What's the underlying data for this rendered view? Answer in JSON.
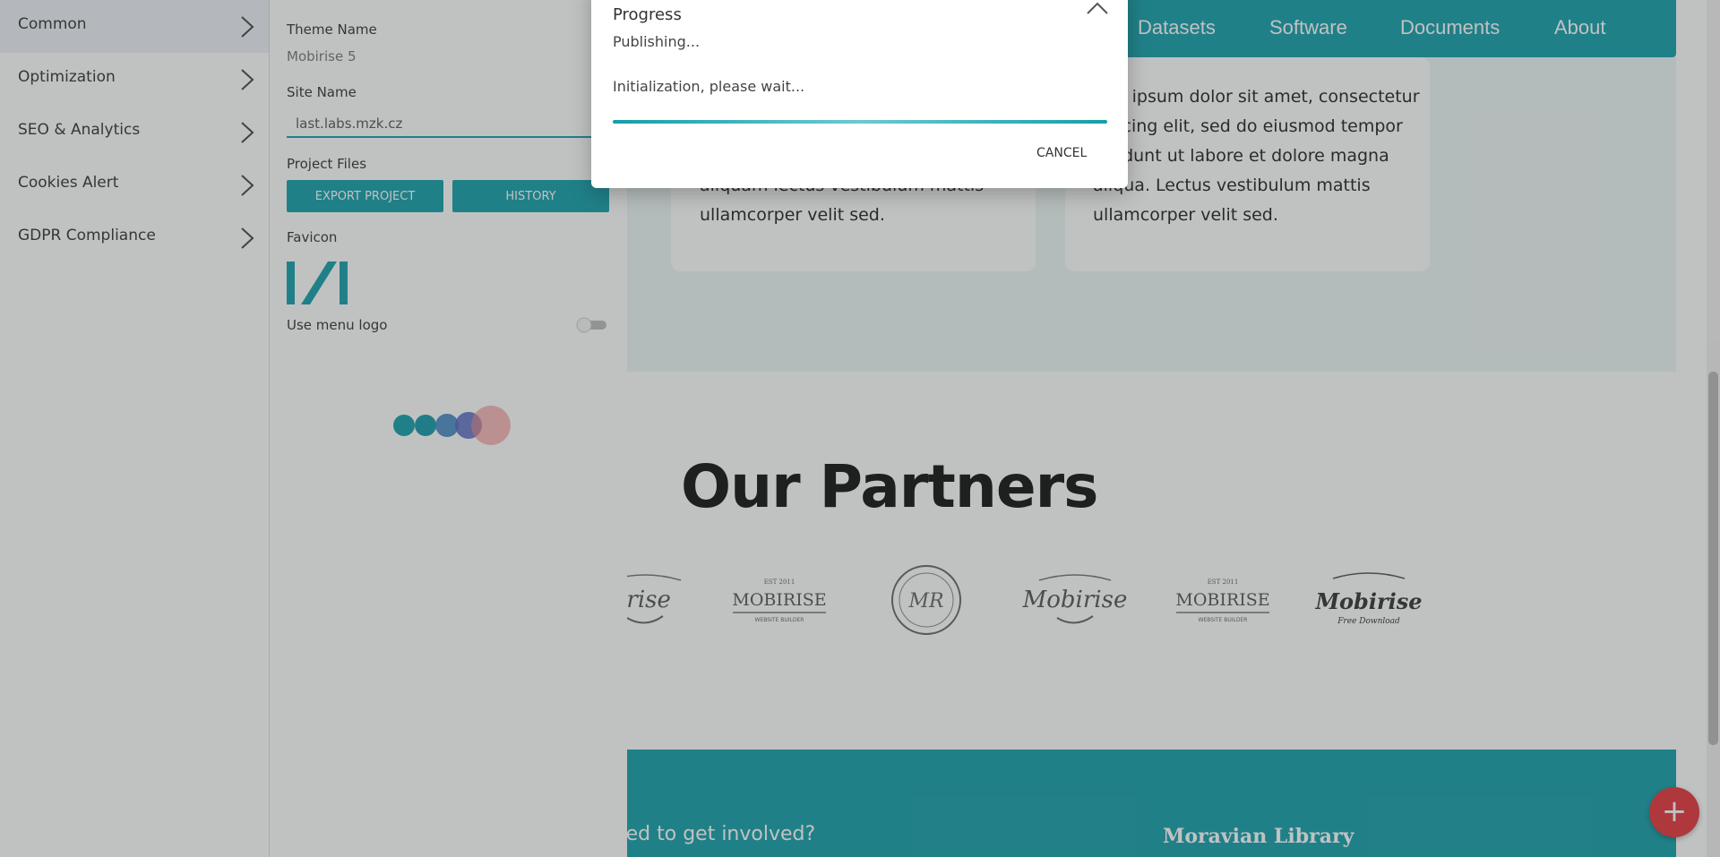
{
  "site": {
    "nav": [
      "Datasets",
      "Software",
      "Documents",
      "About"
    ],
    "cards": [
      {
        "lines": [
          "aliquam lectus vestibulum mattis",
          "ullamcorper velit sed."
        ]
      },
      {
        "lines": [
          "rem ipsum dolor sit amet, consectetur",
          "ipiscing elit, sed do eiusmod tempor",
          "cididunt ut labore et dolore magna",
          "aliqua. Lectus vestibulum mattis",
          "ullamcorper velit sed."
        ]
      }
    ],
    "partners_title": "Our Partners",
    "partner_logos": [
      "mobirise-script-logo",
      "mobirise-est-logo",
      "mr-seal-logo",
      "mobirise-script-logo",
      "mobirise-est-logo",
      "mobirise-free-download-logo"
    ],
    "footer_cta": "ted to get involved?",
    "footer_brand": "Moravian Library",
    "fab_icon": "plus-icon"
  },
  "sidebar": {
    "items": [
      {
        "label": "Common",
        "active": true
      },
      {
        "label": "Optimization"
      },
      {
        "label": "SEO & Analytics"
      },
      {
        "label": "Cookies Alert"
      },
      {
        "label": "GDPR Compliance"
      }
    ]
  },
  "settings": {
    "theme_name_label": "Theme Name",
    "theme_name_value": "Mobirise 5",
    "site_name_label": "Site Name",
    "site_name_value": "last.labs.mzk.cz",
    "project_files_label": "Project Files",
    "export_button": "EXPORT PROJECT",
    "history_button": "HISTORY",
    "favicon_label": "Favicon",
    "use_menu_logo_label": "Use menu logo",
    "use_menu_logo_enabled": false
  },
  "dialog": {
    "title": "Progress",
    "status": "Publishing...",
    "message": "Initialization, please wait...",
    "progress": 1.0,
    "cancel_label": "CANCEL"
  },
  "colors": {
    "accent": "#149eaa",
    "fab": "#e5343a"
  }
}
